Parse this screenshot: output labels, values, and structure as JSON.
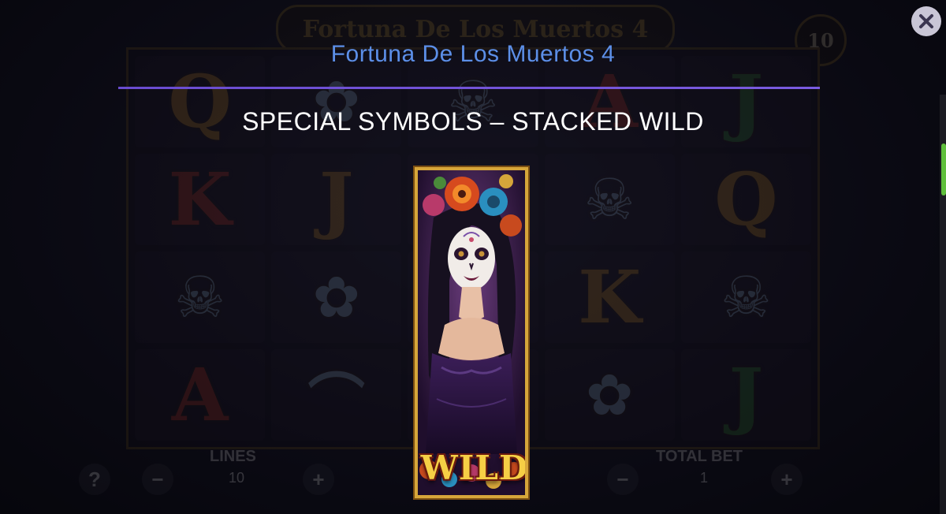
{
  "dialog": {
    "title": "Fortuna De Los Muertos 4",
    "section_heading": "SPECIAL SYMBOLS – STACKED WILD",
    "close_label": "×"
  },
  "symbol": {
    "name": "WILD"
  },
  "background_game": {
    "title_plate": "Fortuna De Los Muertos 4",
    "lines_counter": "10",
    "reel_symbols": [
      [
        "Q",
        "",
        "",
        "A",
        "J"
      ],
      [
        "K",
        "J",
        "",
        "",
        "Q"
      ],
      [
        "",
        "",
        "",
        "K",
        ""
      ],
      [
        "A",
        "",
        "",
        "",
        "J"
      ]
    ],
    "lines_label": "LINES",
    "lines_value": "10",
    "total_bet_label": "TOTAL BET",
    "total_bet_value": "1",
    "help_button": "?",
    "minus_symbol": "−",
    "plus_symbol": "+"
  },
  "colors": {
    "title_blue": "#5c8fe8",
    "divider_purple": "#6a4cd0",
    "gold_frame": "#d6a63a",
    "scroll_thumb": "#5fbf3c"
  },
  "icons": {
    "close": "close-icon",
    "card_art": "catrina-wild-portrait"
  }
}
